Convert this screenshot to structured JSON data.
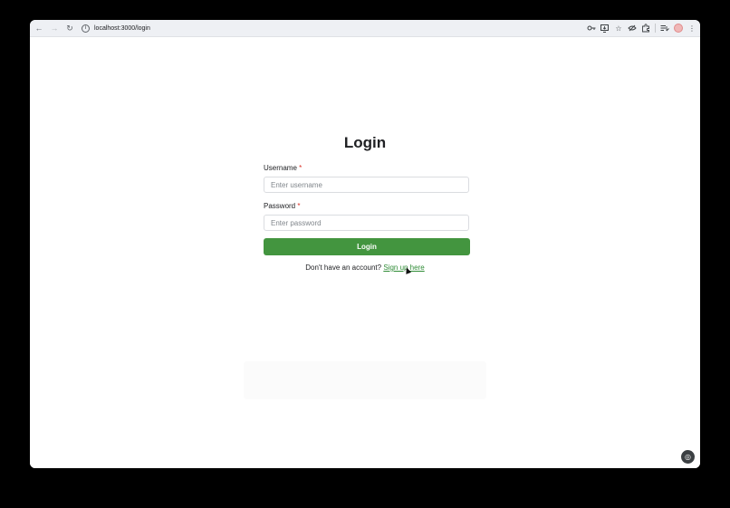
{
  "browser": {
    "url": "localhost:3000/login",
    "tab_hint": "",
    "icons": {
      "back": "back-arrow-icon",
      "forward": "forward-arrow-icon",
      "reload": "reload-icon",
      "info": "site-info-icon",
      "key": "password-key-icon",
      "install": "install-app-icon",
      "star": "bookmark-star-icon",
      "eye": "hidden-eye-icon",
      "extensions": "extensions-puzzle-icon",
      "reading_list": "reading-list-icon",
      "profile": "profile-avatar",
      "menu": "kebab-menu-icon"
    },
    "avatar_text": ""
  },
  "login": {
    "title": "Login",
    "username_label": "Username",
    "username_placeholder": "Enter username",
    "password_label": "Password",
    "password_placeholder": "Enter password",
    "required_marker": "*",
    "button_label": "Login",
    "signup_prompt": "Don't have an account?",
    "signup_link": "Sign up here"
  },
  "colors": {
    "primary_button": "#43953f",
    "link": "#2e8b35",
    "required": "#d93025"
  }
}
